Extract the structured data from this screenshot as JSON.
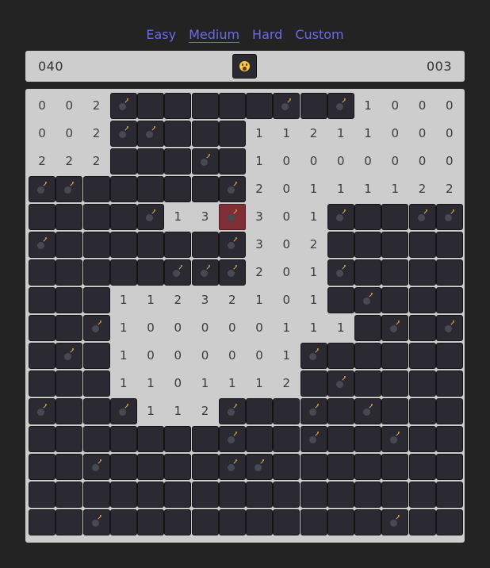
{
  "nav": {
    "difficulties": [
      {
        "label": "Easy",
        "active": false
      },
      {
        "label": "Medium",
        "active": true
      },
      {
        "label": "Hard",
        "active": false
      },
      {
        "label": "Custom",
        "active": false
      }
    ],
    "accent_color": "#6b6be6"
  },
  "header": {
    "mines_remaining": "040",
    "timer": "003",
    "face_icon": "surprised-face-icon"
  },
  "board": {
    "rows": 16,
    "cols": 16,
    "legend": {
      "#": "hidden",
      "B": "mine",
      "X": "exploded-mine",
      "0-8": "revealed-number"
    },
    "grid": [
      "002B####B#B1000",
      "002BB###1121100",
      "222###B#1000000",
      "BB#####B2011122",
      "####B13X301B##BB",
      "B######B302#####",
      "#####BBB201B####",
      "###11232101#B###",
      "##B1000001 1#B#B",
      "#B#1000001B#####",
      "###110111 2#B####",
      "B##B112B##B#B###",
      "#######B##B##B###",
      "##B####BB#######",
      "################",
      "##B##########B##"
    ]
  }
}
